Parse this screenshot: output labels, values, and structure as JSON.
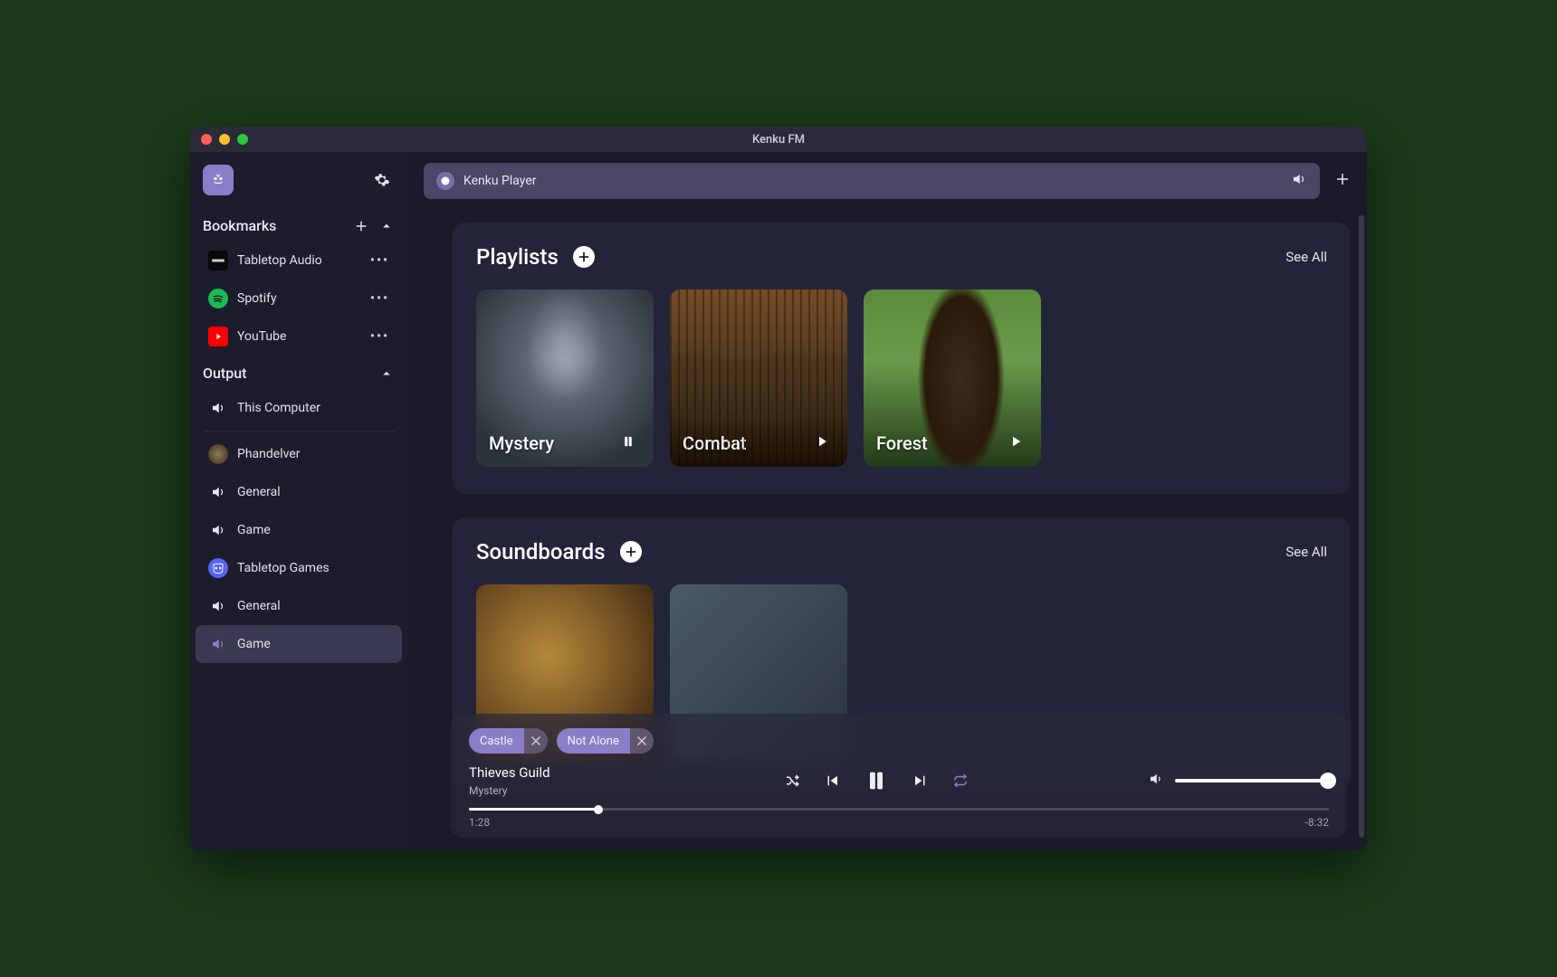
{
  "window": {
    "title": "Kenku FM"
  },
  "sidebar": {
    "bookmarks": {
      "title": "Bookmarks",
      "items": [
        {
          "label": "Tabletop Audio",
          "icon": "tabletop-audio"
        },
        {
          "label": "Spotify",
          "icon": "spotify"
        },
        {
          "label": "YouTube",
          "icon": "youtube"
        }
      ]
    },
    "output": {
      "title": "Output",
      "items": [
        {
          "label": "This Computer",
          "icon": "speaker"
        },
        {
          "label": "Phandelver",
          "icon": "avatar"
        },
        {
          "label": "General",
          "icon": "speaker",
          "indent": true
        },
        {
          "label": "Game",
          "icon": "speaker",
          "indent": true
        },
        {
          "label": "Tabletop Games",
          "icon": "discord"
        },
        {
          "label": "General",
          "icon": "speaker",
          "indent": true
        },
        {
          "label": "Game",
          "icon": "speaker",
          "indent": true,
          "active": true
        }
      ]
    }
  },
  "topbar": {
    "player_label": "Kenku Player"
  },
  "sections": {
    "playlists": {
      "title": "Playlists",
      "see_all": "See All",
      "cards": [
        {
          "label": "Mystery",
          "state": "pause"
        },
        {
          "label": "Combat",
          "state": "play"
        },
        {
          "label": "Forest",
          "state": "play"
        }
      ]
    },
    "soundboards": {
      "title": "Soundboards",
      "see_all": "See All"
    }
  },
  "now_playing": {
    "chips": [
      {
        "label": "Castle"
      },
      {
        "label": "Not Alone"
      }
    ],
    "track_title": "Thieves Guild",
    "track_sub": "Mystery",
    "elapsed": "1:28",
    "remaining": "-8:32",
    "progress_pct": 15,
    "volume_pct": 100
  },
  "colors": {
    "accent": "#8b7ec8",
    "panel": "#23243a",
    "bg": "#1a1a2a"
  }
}
